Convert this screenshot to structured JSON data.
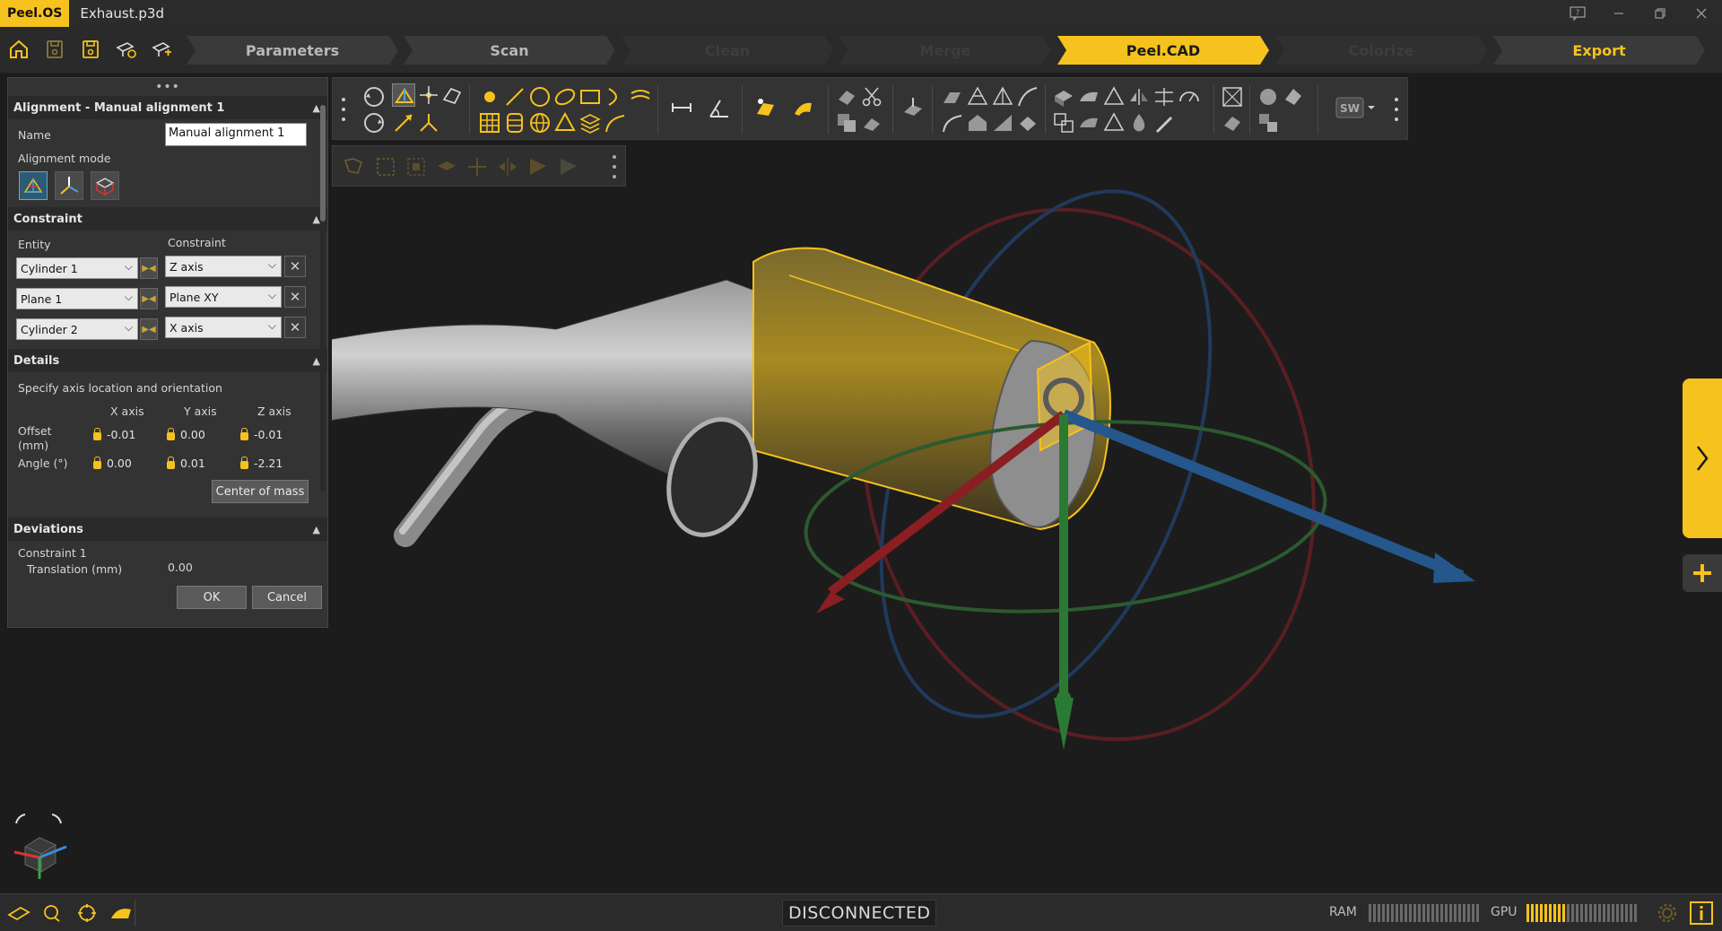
{
  "window": {
    "app_logo": "Peel.OS",
    "file_name": "Exhaust.p3d"
  },
  "workflow": {
    "steps": [
      {
        "label": "Parameters",
        "state": "normal"
      },
      {
        "label": "Scan",
        "state": "normal"
      },
      {
        "label": "Clean",
        "state": "disabled"
      },
      {
        "label": "Merge",
        "state": "disabled"
      },
      {
        "label": "Peel.CAD",
        "state": "active"
      },
      {
        "label": "Colorize",
        "state": "disabled"
      },
      {
        "label": "Export",
        "state": "export"
      }
    ]
  },
  "panel": {
    "title": "Alignment - Manual alignment 1",
    "name_label": "Name",
    "name_value": "Manual alignment 1",
    "mode_label": "Alignment mode",
    "constraint_section": "Constraint",
    "entity_header": "Entity",
    "constraint_header": "Constraint",
    "rows": [
      {
        "entity": "Cylinder 1",
        "constraint": "Z axis"
      },
      {
        "entity": "Plane 1",
        "constraint": "Plane XY"
      },
      {
        "entity": "Cylinder 2",
        "constraint": "X axis"
      }
    ],
    "details_section": "Details",
    "details_desc": "Specify axis location and orientation",
    "x_axis": "X axis",
    "y_axis": "Y axis",
    "z_axis": "Z axis",
    "offset_label": "Offset",
    "offset_unit": "(mm)",
    "offset": [
      "-0.01",
      "0.00",
      "-0.01"
    ],
    "angle_label": "Angle (°)",
    "angle": [
      "0.00",
      "0.01",
      "-2.21"
    ],
    "center_of_mass": "Center of mass",
    "deviations_section": "Deviations",
    "dev_constraint": "Constraint 1",
    "dev_translation_label": "Translation (mm)",
    "dev_translation_value": "0.00",
    "ok": "OK",
    "cancel": "Cancel"
  },
  "status": {
    "connection": "DISCONNECTED",
    "ram_label": "RAM",
    "gpu_label": "GPU",
    "ram_level": 0.0,
    "gpu_level": 0.35
  },
  "colors": {
    "accent": "#f6c21d",
    "axis_x": "#c0262a",
    "axis_y": "#2e9a3a",
    "axis_z": "#2b6fb0"
  }
}
